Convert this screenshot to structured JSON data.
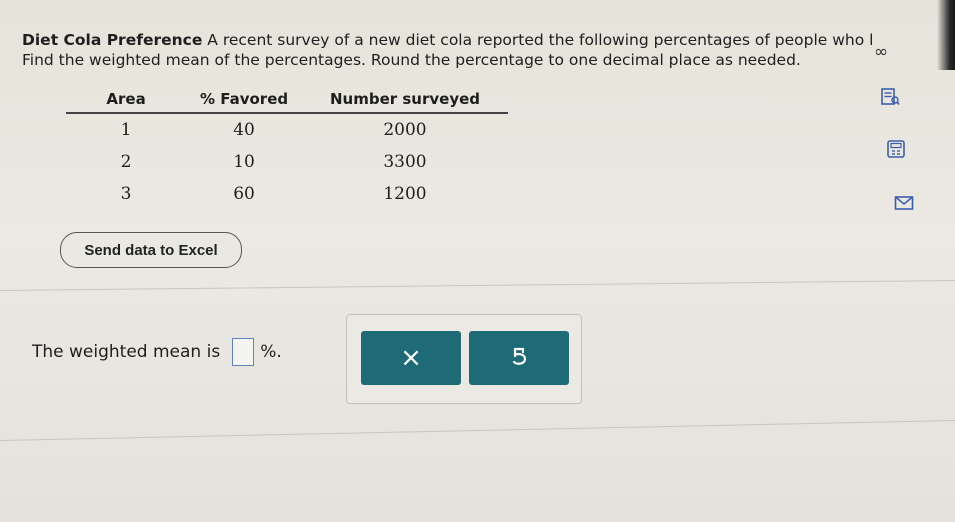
{
  "question": {
    "title": "Diet Cola Preference",
    "line1_rest": " A recent survey of a new diet cola reported the following percentages of people who l",
    "line2": "Find the weighted mean of the percentages. Round the percentage to one decimal place as needed."
  },
  "table": {
    "headers": [
      "Area",
      "% Favored",
      "Number surveyed"
    ],
    "rows": [
      [
        "1",
        "40",
        "2000"
      ],
      [
        "2",
        "10",
        "3300"
      ],
      [
        "3",
        "60",
        "1200"
      ]
    ]
  },
  "excel_button": {
    "label": "Send data to Excel"
  },
  "answer": {
    "prefix": "The weighted mean is",
    "suffix": "%.",
    "value": ""
  },
  "panel": {
    "clear_symbol": "×",
    "undo_icon": "undo-icon"
  },
  "colors": {
    "panel_button": "#1f6a77",
    "input_border": "#5e84c8",
    "tool_icon": "#3a5fb0"
  }
}
